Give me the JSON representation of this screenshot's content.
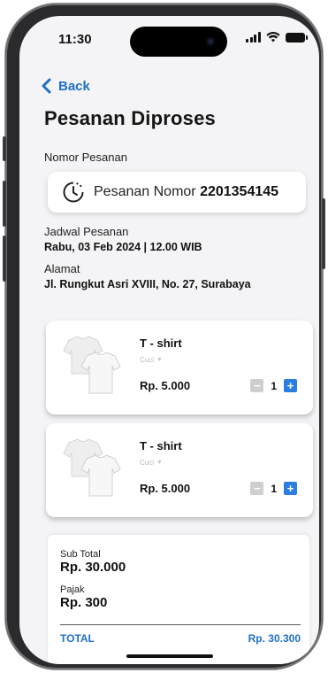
{
  "status_bar": {
    "time": "11:30"
  },
  "header": {
    "back_label": "Back",
    "title": "Pesanan Diproses"
  },
  "order": {
    "number_label": "Nomor Pesanan",
    "number_prefix": "Pesanan Nomor ",
    "number_value": "2201354145",
    "schedule_label": "Jadwal Pesanan",
    "schedule_value": "Rabu, 03 Feb 2024 | 12.00 WIB",
    "address_label": "Alamat",
    "address_value": "Jl. Rungkut Asri XVIII, No. 27, Surabaya"
  },
  "items": [
    {
      "name": "T - shirt",
      "service": "Cuci",
      "price": "Rp. 5.000",
      "qty": "1"
    },
    {
      "name": "T - shirt",
      "service": "Cuci",
      "price": "Rp. 5.000",
      "qty": "1"
    }
  ],
  "stepper": {
    "minus": "−",
    "plus": "+"
  },
  "summary": {
    "subtotal_label": "Sub Total",
    "subtotal_value": "Rp. 30.000",
    "tax_label": "Pajak",
    "tax_value": "Rp. 300",
    "total_label": "TOTAL",
    "total_value": "Rp. 30.300"
  },
  "icons": {
    "back": "chevron-left-icon",
    "clock": "clock-icon",
    "signal": "signal-icon",
    "wifi": "wifi-icon",
    "battery": "battery-icon",
    "dropdown": "caret-down-icon",
    "product": "tshirt-icon"
  },
  "colors": {
    "accent": "#1f6fc6",
    "plus_button": "#2a7de1",
    "minus_button": "#cfcfcf",
    "background": "#f4f4f6"
  }
}
